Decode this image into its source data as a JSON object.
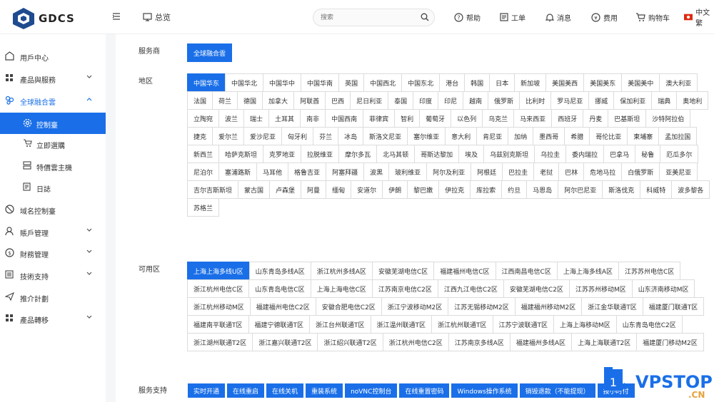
{
  "header": {
    "brand": "GDCS",
    "console": "总览",
    "search_placeholder": "搜索",
    "help": "帮助",
    "tickets": "工单",
    "messages": "消息",
    "billing": "费用",
    "cart": "购物车",
    "language": "中文繁"
  },
  "sidebar": {
    "items": [
      {
        "label": "用戶中心",
        "icon": "user-circle-icon"
      },
      {
        "label": "產品與服務",
        "icon": "grid-icon"
      },
      {
        "label": "全球融合雲",
        "icon": "cloud-fusion-icon"
      },
      {
        "label": "控制臺",
        "icon": "gear-icon"
      },
      {
        "label": "立即選購",
        "icon": "cart-icon"
      },
      {
        "label": "特價雲主機",
        "icon": "server-icon"
      },
      {
        "label": "日誌",
        "icon": "document-icon"
      },
      {
        "label": "域名控制臺",
        "icon": "globe-icon"
      },
      {
        "label": "賬戶管理",
        "icon": "person-icon"
      },
      {
        "label": "財務管理",
        "icon": "money-icon"
      },
      {
        "label": "技術支持",
        "icon": "wrench-icon"
      },
      {
        "label": "推介計劃",
        "icon": "paper-plane-icon"
      },
      {
        "label": "產品轉移",
        "icon": "grid-icon"
      }
    ]
  },
  "provider": {
    "label": "服务商",
    "options": [
      "全球融合雲"
    ],
    "selected": "全球融合雲"
  },
  "region": {
    "label": "地区",
    "selected": "中国华东",
    "options": [
      "中国华东",
      "中国华北",
      "中国华中",
      "中国华南",
      "英国",
      "中国西北",
      "中国东北",
      "港台",
      "韩国",
      "日本",
      "新加坡",
      "美国美西",
      "美国美东",
      "美国美中",
      "澳大利亚",
      "法国",
      "荷兰",
      "德国",
      "加拿大",
      "阿联酋",
      "巴西",
      "尼日利亚",
      "泰国",
      "印度",
      "印尼",
      "越南",
      "俄罗斯",
      "比利时",
      "罗马尼亚",
      "挪威",
      "保加利亚",
      "瑞典",
      "奥地利",
      "立陶宛",
      "波兰",
      "瑞士",
      "土耳其",
      "南非",
      "中国西南",
      "菲律宾",
      "智利",
      "葡萄牙",
      "以色列",
      "乌克兰",
      "马来西亚",
      "西班牙",
      "丹麦",
      "巴基斯坦",
      "沙特阿拉伯",
      "捷克",
      "爱尔兰",
      "爱沙尼亚",
      "匈牙利",
      "芬兰",
      "冰岛",
      "斯洛文尼亚",
      "塞尔维亚",
      "意大利",
      "肯尼亚",
      "加纳",
      "墨西哥",
      "希腊",
      "哥伦比亚",
      "柬埔寨",
      "孟加拉国",
      "新西兰",
      "哈萨克斯坦",
      "克罗地亚",
      "拉脱维亚",
      "摩尔多瓦",
      "北马其顿",
      "哥斯达黎加",
      "埃及",
      "乌兹别克斯坦",
      "乌拉圭",
      "委内瑞拉",
      "巴拿马",
      "秘鲁",
      "厄瓜多尔",
      "尼泊尔",
      "塞浦路斯",
      "马耳他",
      "格鲁吉亚",
      "阿塞拜疆",
      "波黑",
      "玻利维亚",
      "阿尔及利亚",
      "阿根廷",
      "巴拉圭",
      "老挝",
      "巴林",
      "危地马拉",
      "白俄罗斯",
      "亚美尼亚",
      "吉尔吉斯斯坦",
      "蒙古国",
      "卢森堡",
      "阿曼",
      "缅甸",
      "安道尔",
      "伊朗",
      "黎巴嫩",
      "伊拉克",
      "库拉索",
      "约旦",
      "马恩岛",
      "阿尔巴尼亚",
      "斯洛伐克",
      "科威特",
      "波多黎各",
      "苏格兰"
    ]
  },
  "zone": {
    "label": "可用区",
    "selected": "上海上海多线U区",
    "options": [
      "上海上海多线U区",
      "山东青岛多线A区",
      "浙江杭州多线A区",
      "安徽芜湖电信C区",
      "福建福州电信C区",
      "江西南昌电信C区",
      "上海上海多线A区",
      "江苏苏州电信C区",
      "浙江杭州电信C区",
      "山东青岛电信C区",
      "上海上海电信C区",
      "江苏南京电信C2区",
      "江西九江电信C2区",
      "安徽芜湖电信C2区",
      "江苏苏州移动M区",
      "山东济南移动M区",
      "浙江杭州移动M区",
      "福建福州电信C2区",
      "安徽合肥电信C2区",
      "浙江宁波移动M2区",
      "江苏无锡移动M2区",
      "福建福州移动M2区",
      "浙江金华联通T区",
      "福建厦门联通T区",
      "福建南平联通T区",
      "福建宁德联通T区",
      "浙江台州联通T区",
      "浙江温州联通T区",
      "浙江杭州联通T区",
      "江苏宁波联通T区",
      "上海上海移动M区",
      "山东青岛电信C2区",
      "浙江湖州联通T2区",
      "浙江嘉兴联通T2区",
      "浙江绍兴联通T2区",
      "浙江杭州电信C2区",
      "江苏南京多线A区",
      "福建福州多线A区",
      "上海上海联通T2区",
      "福建厦门移动M2区"
    ]
  },
  "support": {
    "label": "服务支持",
    "features": [
      "实时开通",
      "在线重启",
      "在线关机",
      "重装系统",
      "noVNC控制台",
      "在线重置密码",
      "Windows操作系统",
      "销毁退款（不能提现）",
      "按小时付"
    ]
  },
  "watermark": {
    "text": "VPSTOP",
    ".cn": ".CN",
    "badge": "1"
  },
  "colors": {
    "accent": "#1a6fe8",
    "brand_dark": "#1f4b8f"
  }
}
